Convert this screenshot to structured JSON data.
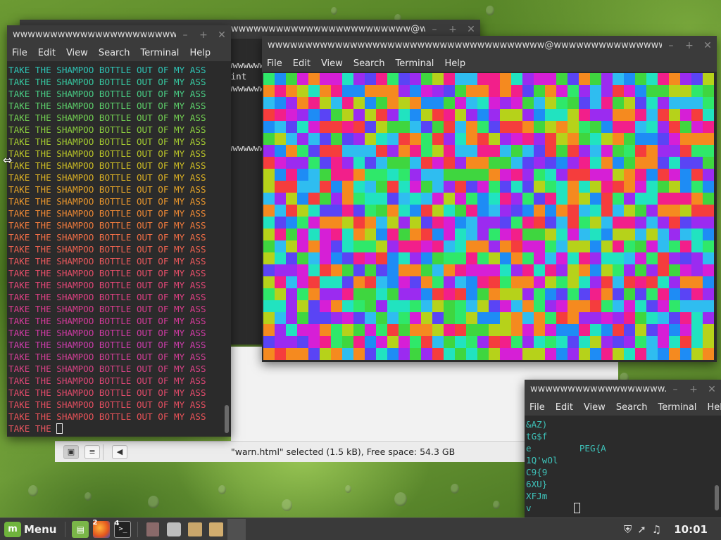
{
  "desktop": {
    "accent": "#6fb43c"
  },
  "background_terminal": {
    "title": "wwwwwwwwwwwwwwwwwwwwwwww@wwwwwwwwwwwwwwwwww...",
    "visible_fragments": [
      "wwwwwwwwwww",
      "aint",
      "wwwwwwwwwwwwwww",
      "wwwwwwwwwwwwwww"
    ]
  },
  "left_terminal": {
    "title": "wwwwwwwwwwwwwwwwwwwwww...",
    "menu": [
      "File",
      "Edit",
      "View",
      "Search",
      "Terminal",
      "Help"
    ],
    "repeated_line": "TAKE THE SHAMPOO BOTTLE OUT OF MY ASS",
    "line_count": 30,
    "line_colors": [
      "#2ec4b6",
      "#36c8a0",
      "#48cc84",
      "#5ccf6a",
      "#72d052",
      "#8cce3e",
      "#a4ca30",
      "#bac428",
      "#ccbc24",
      "#dab024",
      "#e4a428",
      "#ea962c",
      "#ee8834",
      "#f07a3c",
      "#f06e46",
      "#ee6250",
      "#ea585c",
      "#e64e68",
      "#e24676",
      "#de4082",
      "#da3c8e",
      "#d63a9a",
      "#d03aa4",
      "#cc3caa",
      "#d13e96",
      "#d84286",
      "#dc4676",
      "#e04a6a",
      "#e44e60",
      "#e85258"
    ],
    "last_line": "TAKE THE ",
    "last_line_color": "#e85660"
  },
  "pixel_terminal": {
    "title": "wwwwwwwwwwwwwwwwwwwwwwwwwwwwwwwwwwwww@wwwwwwwwwwwwwwwwwwww...",
    "menu": [
      "File",
      "Edit",
      "View",
      "Search",
      "Terminal",
      "Help"
    ],
    "palette": [
      "#2fe86a",
      "#9b2bf0",
      "#f21f8a",
      "#2fbdf0",
      "#f58a1f",
      "#5a44f5",
      "#b6d21a",
      "#21e3c0",
      "#1e8cf5",
      "#d61fd6",
      "#f53d3d",
      "#3fd63f"
    ]
  },
  "file_manager": {
    "status_text": "\"warn.html\" selected (1.5 kB), Free space: 54.3 GB"
  },
  "small_terminal": {
    "title": "wwwwwwwwwwwwwwwwww...",
    "menu": [
      "File",
      "Edit",
      "View",
      "Search",
      "Terminal",
      "Help"
    ],
    "lines": [
      "&AZ)",
      "tG$f",
      "e         PEG{A",
      "1Q'wOl",
      "C9{9",
      "6XU}",
      "XFJm",
      "v"
    ],
    "text_color": "#3ec2b9"
  },
  "taskbar": {
    "menu_label": "Menu",
    "files_badge": "2",
    "terminal_badge": "4",
    "clock": "10:01"
  }
}
